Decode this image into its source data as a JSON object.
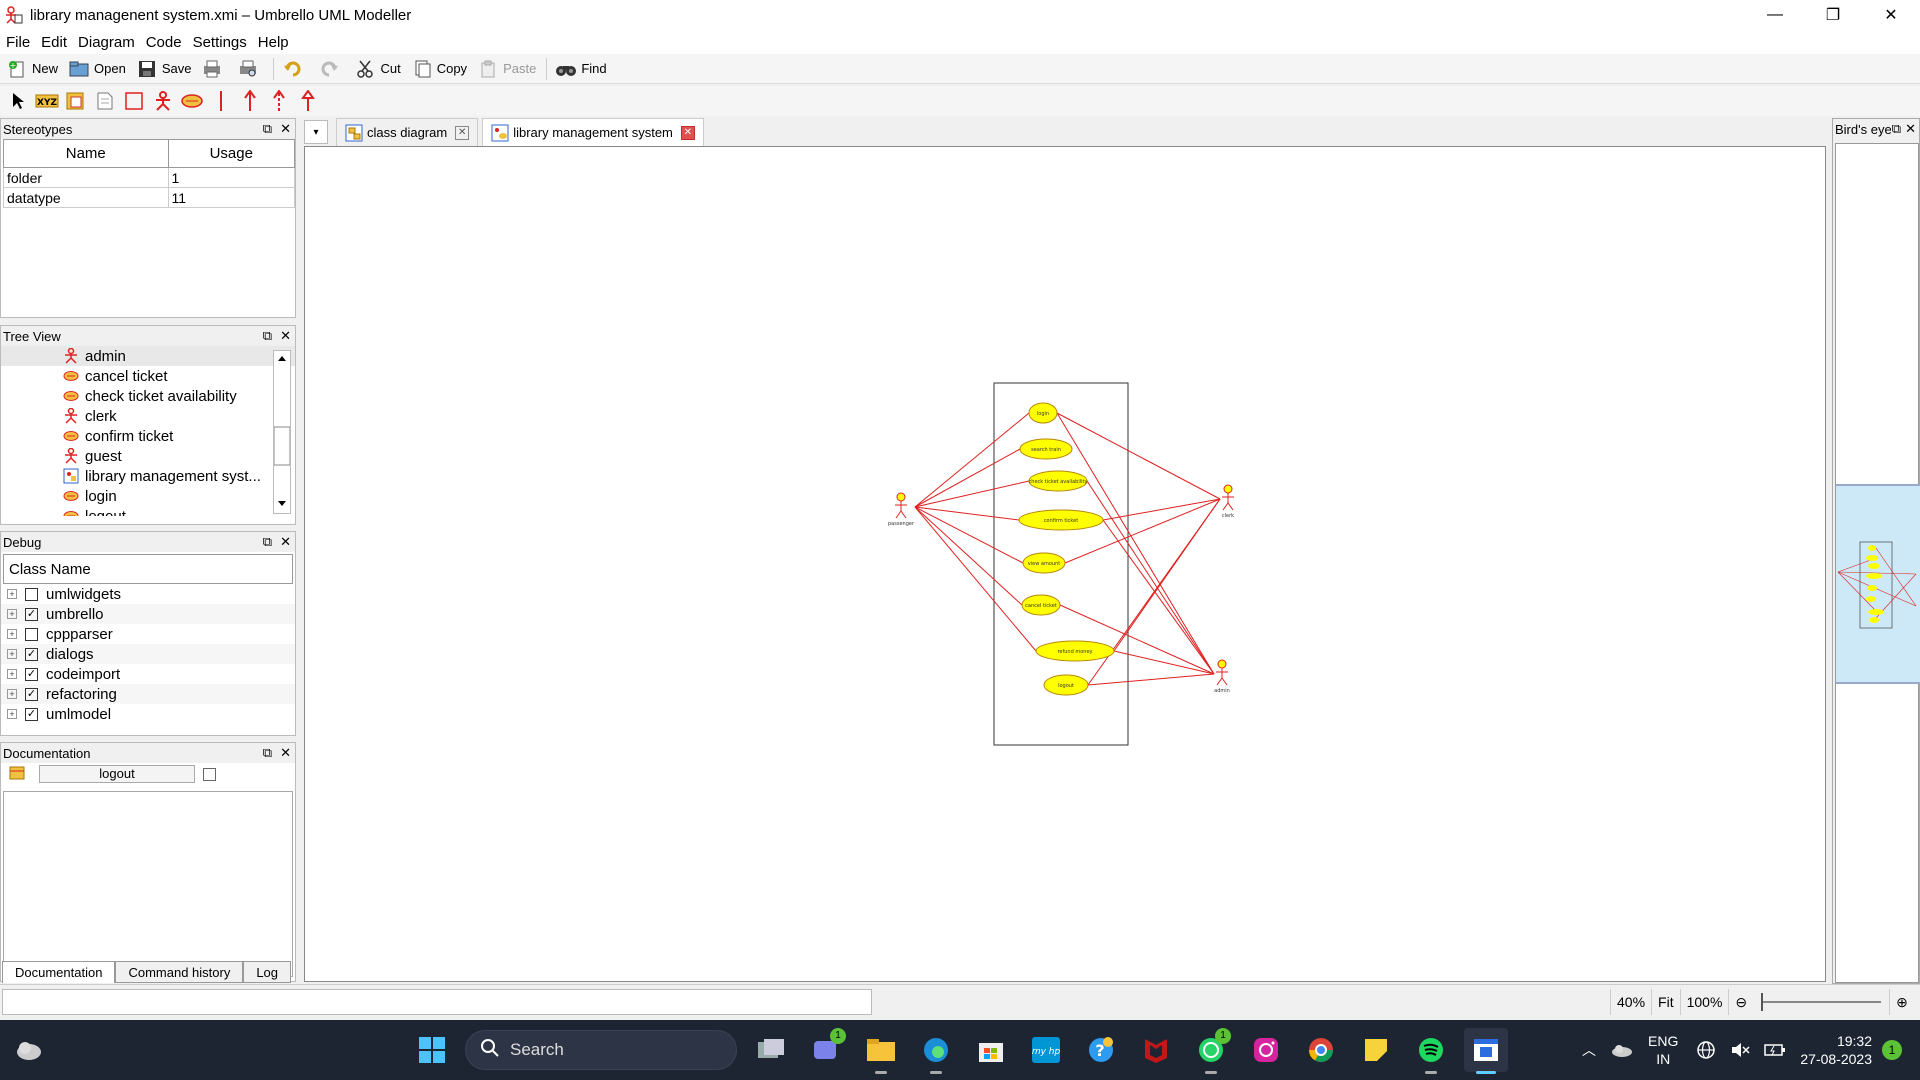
{
  "window": {
    "title": "library managenent system.xmi – Umbrello UML Modeller",
    "minimize": "—",
    "restore": "❐",
    "close": "✕"
  },
  "menubar": [
    "File",
    "Edit",
    "Diagram",
    "Code",
    "Settings",
    "Help"
  ],
  "toolbar": {
    "new": "New",
    "open": "Open",
    "save": "Save",
    "cut": "Cut",
    "copy": "Copy",
    "paste": "Paste",
    "find": "Find"
  },
  "stereotypes": {
    "title": "Stereotypes",
    "columns": [
      "Name",
      "Usage"
    ],
    "rows": [
      {
        "name": "folder",
        "usage": "1"
      },
      {
        "name": "datatype",
        "usage": "11"
      }
    ]
  },
  "tree": {
    "title": "Tree View",
    "items": [
      {
        "label": "admin",
        "icon": "actor-icon"
      },
      {
        "label": "cancel ticket",
        "icon": "usecase-icon"
      },
      {
        "label": "check ticket availability",
        "icon": "usecase-icon"
      },
      {
        "label": "clerk",
        "icon": "actor-icon"
      },
      {
        "label": "confirm ticket",
        "icon": "usecase-icon"
      },
      {
        "label": "guest",
        "icon": "actor-icon"
      },
      {
        "label": "library management syst...",
        "icon": "diagram-icon"
      },
      {
        "label": "login",
        "icon": "usecase-icon"
      },
      {
        "label": "logout",
        "icon": "usecase-icon"
      }
    ]
  },
  "debug": {
    "title": "Debug",
    "column": "Class Name",
    "items": [
      {
        "label": "umlwidgets",
        "checked": false
      },
      {
        "label": "umbrello",
        "checked": true
      },
      {
        "label": "cppparser",
        "checked": false
      },
      {
        "label": "dialogs",
        "checked": true
      },
      {
        "label": "codeimport",
        "checked": true
      },
      {
        "label": "refactoring",
        "checked": true
      },
      {
        "label": "umlmodel",
        "checked": true
      }
    ]
  },
  "documentation": {
    "title": "Documentation",
    "name": "logout"
  },
  "bottom_tabs": [
    "Documentation",
    "Command history",
    "Log"
  ],
  "diagram_tabs": [
    {
      "label": "class diagram",
      "active": false
    },
    {
      "label": "library management system",
      "active": true
    }
  ],
  "diagram": {
    "actors": [
      {
        "name": "passenger"
      },
      {
        "name": "clerk"
      },
      {
        "name": "admin"
      }
    ],
    "usecases": [
      {
        "name": "login"
      },
      {
        "name": "search train"
      },
      {
        "name": "check ticket availability"
      },
      {
        "name": "confirm ticket"
      },
      {
        "name": "view amount"
      },
      {
        "name": "cancel ticket"
      },
      {
        "name": "refund money"
      },
      {
        "name": "logout"
      }
    ],
    "colors": {
      "usecase_fill": "#ffff00",
      "line": "#e02020",
      "outline": "#b8860b"
    }
  },
  "birds_eye": {
    "title": "Bird's eye"
  },
  "statusbar": {
    "zoom": "40%",
    "fit": "Fit",
    "full": "100%"
  },
  "taskbar": {
    "search": "Search",
    "lang1": "ENG",
    "lang2": "IN",
    "time": "19:32",
    "date": "27-08-2023",
    "notifications": "1",
    "teams_badge": "1",
    "whatsapp_badge": "1"
  }
}
